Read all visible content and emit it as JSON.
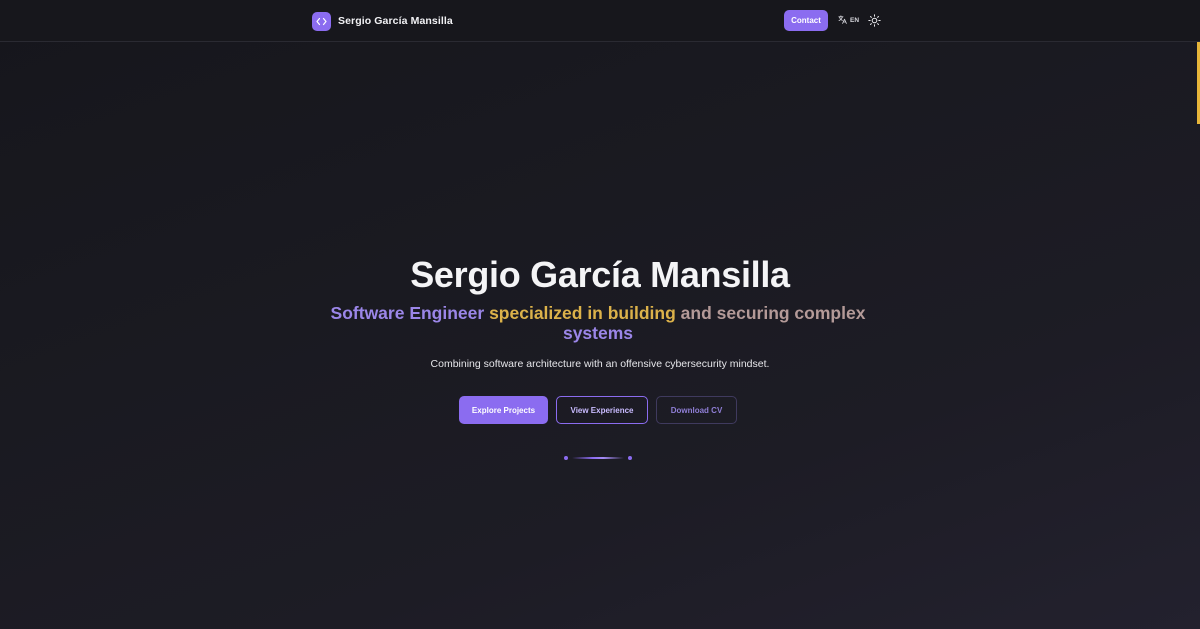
{
  "navbar": {
    "brand_name": "Sergio García Mansilla",
    "brand_icon": "code-brackets-icon",
    "contact_label": "Contact",
    "language_label": "EN",
    "language_icon": "translate-icon",
    "theme_icon": "sun-icon"
  },
  "hero": {
    "title": "Sergio García Mansilla",
    "subtitle": {
      "part1": "Software Engineer",
      "part2": "specialized in building",
      "part3": "and securing complex",
      "part4": "systems"
    },
    "description": "Combining software architecture with an offensive cybersecurity mindset.",
    "buttons": {
      "explore": "Explore Projects",
      "experience": "View Experience",
      "download": "Download CV"
    }
  },
  "colors": {
    "accent": "#8b6cf0",
    "gold": "#dcb24a",
    "background": "#1a1a21",
    "scroll_accent": "#e7b63a"
  }
}
